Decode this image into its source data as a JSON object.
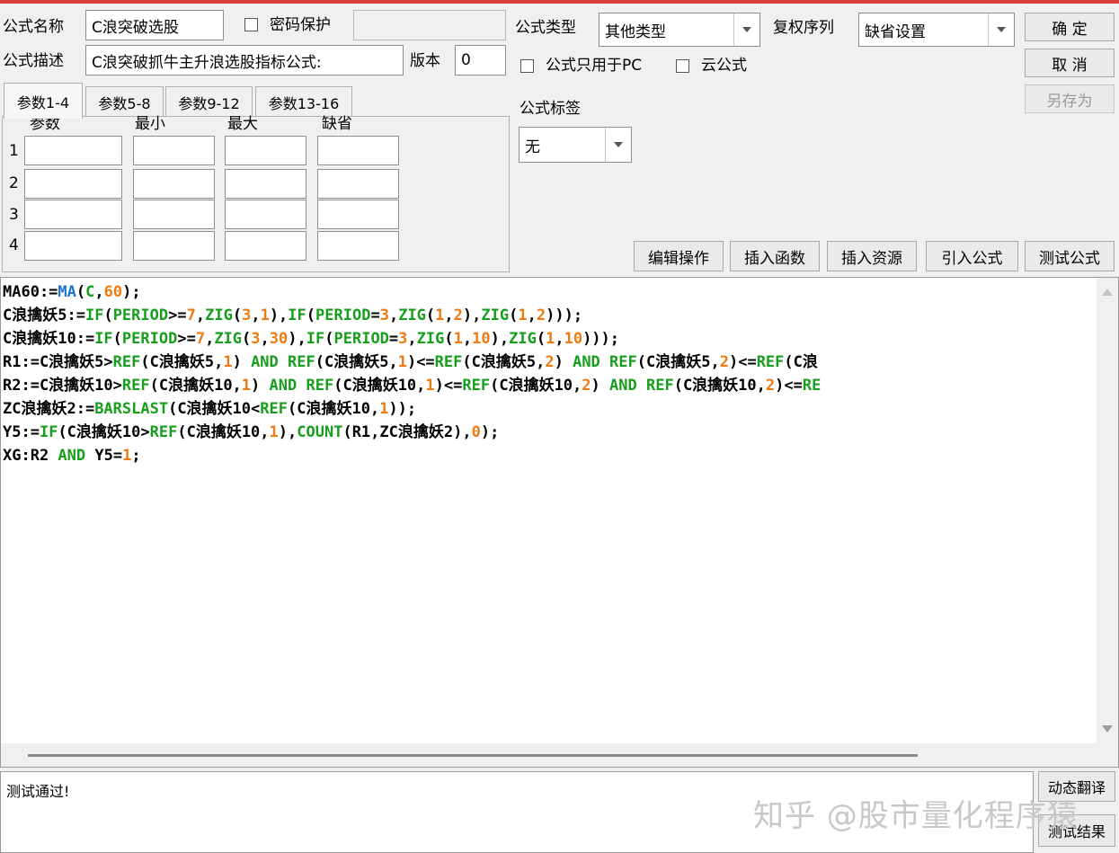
{
  "header": {
    "name_label": "公式名称",
    "name_value": "C浪突破选股",
    "password_label": "密码保护",
    "password_value": "",
    "desc_label": "公式描述",
    "desc_value": "C浪突破抓牛主升浪选股指标公式:",
    "version_label": "版本",
    "version_value": "0",
    "type_label": "公式类型",
    "type_value": "其他类型",
    "rights_label": "复权序列",
    "rights_value": "缺省设置",
    "pc_only_label": "公式只用于PC",
    "cloud_label": "云公式",
    "tag_label": "公式标签",
    "tag_value": "无"
  },
  "buttons": {
    "ok": "确  定",
    "cancel": "取  消",
    "save_as": "另存为",
    "edit_ops": "编辑操作",
    "insert_func": "插入函数",
    "insert_res": "插入资源",
    "import_formula": "引入公式",
    "test_formula": "测试公式",
    "dyn_translate": "动态翻译",
    "test_result": "测试结果"
  },
  "tabs": [
    "参数1-4",
    "参数5-8",
    "参数9-12",
    "参数13-16"
  ],
  "params": {
    "headers": [
      "参数",
      "最小",
      "最大",
      "缺省"
    ],
    "rows": [
      "1",
      "2",
      "3",
      "4"
    ]
  },
  "code_lines": [
    [
      [
        "MA60:=",
        "o"
      ],
      [
        "MA",
        "c"
      ],
      [
        "(",
        "o"
      ],
      [
        "C",
        "f"
      ],
      [
        ",",
        "o"
      ],
      [
        "60",
        "n"
      ],
      [
        ");",
        "o"
      ]
    ],
    [
      [
        "C浪擒妖5:=",
        "o"
      ],
      [
        "IF",
        "f"
      ],
      [
        "(",
        "o"
      ],
      [
        "PERIOD",
        "f"
      ],
      [
        ">=",
        "o"
      ],
      [
        "7",
        "n"
      ],
      [
        ",",
        "o"
      ],
      [
        "ZIG",
        "f"
      ],
      [
        "(",
        "o"
      ],
      [
        "3",
        "n"
      ],
      [
        ",",
        "o"
      ],
      [
        "1",
        "n"
      ],
      [
        "),",
        "o"
      ],
      [
        "IF",
        "f"
      ],
      [
        "(",
        "o"
      ],
      [
        "PERIOD",
        "f"
      ],
      [
        "=",
        "o"
      ],
      [
        "3",
        "n"
      ],
      [
        ",",
        "o"
      ],
      [
        "ZIG",
        "f"
      ],
      [
        "(",
        "o"
      ],
      [
        "1",
        "n"
      ],
      [
        ",",
        "o"
      ],
      [
        "2",
        "n"
      ],
      [
        "),",
        "o"
      ],
      [
        "ZIG",
        "f"
      ],
      [
        "(",
        "o"
      ],
      [
        "1",
        "n"
      ],
      [
        ",",
        "o"
      ],
      [
        "2",
        "n"
      ],
      [
        ")));",
        "o"
      ]
    ],
    [
      [
        "C浪擒妖10:=",
        "o"
      ],
      [
        "IF",
        "f"
      ],
      [
        "(",
        "o"
      ],
      [
        "PERIOD",
        "f"
      ],
      [
        ">=",
        "o"
      ],
      [
        "7",
        "n"
      ],
      [
        ",",
        "o"
      ],
      [
        "ZIG",
        "f"
      ],
      [
        "(",
        "o"
      ],
      [
        "3",
        "n"
      ],
      [
        ",",
        "o"
      ],
      [
        "30",
        "n"
      ],
      [
        "),",
        "o"
      ],
      [
        "IF",
        "f"
      ],
      [
        "(",
        "o"
      ],
      [
        "PERIOD",
        "f"
      ],
      [
        "=",
        "o"
      ],
      [
        "3",
        "n"
      ],
      [
        ",",
        "o"
      ],
      [
        "ZIG",
        "f"
      ],
      [
        "(",
        "o"
      ],
      [
        "1",
        "n"
      ],
      [
        ",",
        "o"
      ],
      [
        "10",
        "n"
      ],
      [
        "),",
        "o"
      ],
      [
        "ZIG",
        "f"
      ],
      [
        "(",
        "o"
      ],
      [
        "1",
        "n"
      ],
      [
        ",",
        "o"
      ],
      [
        "10",
        "n"
      ],
      [
        ")));",
        "o"
      ]
    ],
    [
      [
        "R1:=C浪擒妖5>",
        "o"
      ],
      [
        "REF",
        "f"
      ],
      [
        "(C浪擒妖5,",
        "o"
      ],
      [
        "1",
        "n"
      ],
      [
        ") ",
        "o"
      ],
      [
        "AND",
        "f"
      ],
      [
        " ",
        "o"
      ],
      [
        "REF",
        "f"
      ],
      [
        "(C浪擒妖5,",
        "o"
      ],
      [
        "1",
        "n"
      ],
      [
        ")<=",
        "o"
      ],
      [
        "REF",
        "f"
      ],
      [
        "(C浪擒妖5,",
        "o"
      ],
      [
        "2",
        "n"
      ],
      [
        ") ",
        "o"
      ],
      [
        "AND",
        "f"
      ],
      [
        " ",
        "o"
      ],
      [
        "REF",
        "f"
      ],
      [
        "(C浪擒妖5,",
        "o"
      ],
      [
        "2",
        "n"
      ],
      [
        ")<=",
        "o"
      ],
      [
        "REF",
        "f"
      ],
      [
        "(C浪",
        "o"
      ]
    ],
    [
      [
        "R2:=C浪擒妖10>",
        "o"
      ],
      [
        "REF",
        "f"
      ],
      [
        "(C浪擒妖10,",
        "o"
      ],
      [
        "1",
        "n"
      ],
      [
        ") ",
        "o"
      ],
      [
        "AND",
        "f"
      ],
      [
        " ",
        "o"
      ],
      [
        "REF",
        "f"
      ],
      [
        "(C浪擒妖10,",
        "o"
      ],
      [
        "1",
        "n"
      ],
      [
        ")<=",
        "o"
      ],
      [
        "REF",
        "f"
      ],
      [
        "(C浪擒妖10,",
        "o"
      ],
      [
        "2",
        "n"
      ],
      [
        ") ",
        "o"
      ],
      [
        "AND",
        "f"
      ],
      [
        " ",
        "o"
      ],
      [
        "REF",
        "f"
      ],
      [
        "(C浪擒妖10,",
        "o"
      ],
      [
        "2",
        "n"
      ],
      [
        ")<=",
        "o"
      ],
      [
        "RE",
        "f"
      ]
    ],
    [
      [
        "ZC浪擒妖2:=",
        "o"
      ],
      [
        "BARSLAST",
        "f"
      ],
      [
        "(C浪擒妖10<",
        "o"
      ],
      [
        "REF",
        "f"
      ],
      [
        "(C浪擒妖10,",
        "o"
      ],
      [
        "1",
        "n"
      ],
      [
        "));",
        "o"
      ]
    ],
    [
      [
        "Y5:=",
        "o"
      ],
      [
        "IF",
        "f"
      ],
      [
        "(C浪擒妖10>",
        "o"
      ],
      [
        "REF",
        "f"
      ],
      [
        "(C浪擒妖10,",
        "o"
      ],
      [
        "1",
        "n"
      ],
      [
        "),",
        "o"
      ],
      [
        "COUNT",
        "f"
      ],
      [
        "(R1,ZC浪擒妖2),",
        "o"
      ],
      [
        "0",
        "n"
      ],
      [
        ");",
        "o"
      ]
    ],
    [
      [
        "XG:R2 ",
        "o"
      ],
      [
        "AND",
        "f"
      ],
      [
        " Y5=",
        "o"
      ],
      [
        "1",
        "n"
      ],
      [
        ";",
        "o"
      ]
    ]
  ],
  "output_text": "测试通过!",
  "watermark": "知乎 @股市量化程序猿",
  "colors": {
    "title_bar": "#d9413a",
    "code_function": "#169e1c",
    "code_constant": "#1a73d8",
    "code_number": "#ee7a12",
    "code_default": "#000000"
  }
}
